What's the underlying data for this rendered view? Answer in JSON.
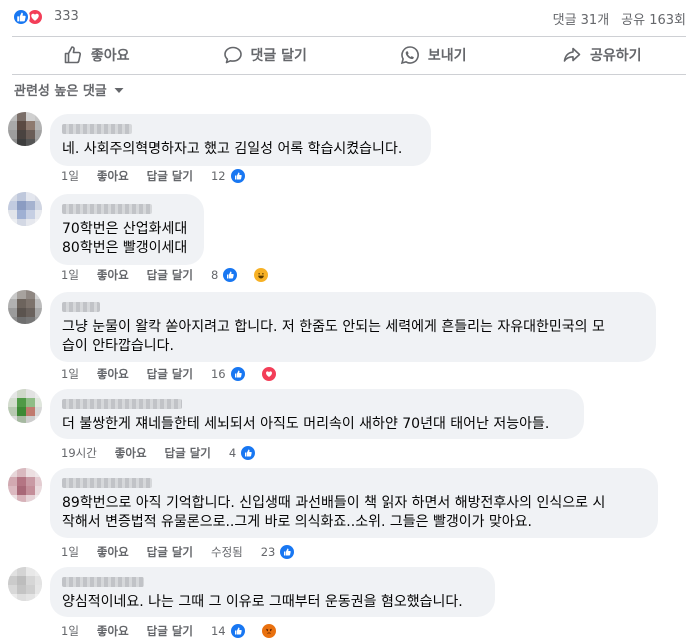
{
  "summary": {
    "reaction_count": "333",
    "comments": "댓글 31개",
    "shares": "공유 163회"
  },
  "actions": {
    "like": "좋아요",
    "comment": "댓글 달기",
    "send": "보내기",
    "share": "공유하기"
  },
  "sort": {
    "label": "관련성 높은 댓글"
  },
  "comments": [
    {
      "text": "네. 사회주의혁명하자고 했고 김일성 어록 학습시켰습니다.",
      "time": "1일",
      "like": "좋아요",
      "reply": "답글 달기",
      "edited": "",
      "reactions": "12"
    },
    {
      "text": "70학번은 산업화세대\n80학번은 빨갱이세대",
      "time": "1일",
      "like": "좋아요",
      "reply": "답글 달기",
      "edited": "",
      "reactions": "8"
    },
    {
      "text": "그냥 눈물이 왈칵 쏟아지려고 합니다. 저 한줌도 안되는 세력에게 흔들리는 자유대한민국의 모\n습이 안타깝습니다.",
      "time": "1일",
      "like": "좋아요",
      "reply": "답글 달기",
      "edited": "",
      "reactions": "16"
    },
    {
      "text": "더 불쌍한게 쟤네들한테 세뇌되서 아직도 머리속이 새하얀 70년대 태어난 저능아들.",
      "time": "19시간",
      "like": "좋아요",
      "reply": "답글 달기",
      "edited": "",
      "reactions": "4"
    },
    {
      "text": "89학번으로 아직 기억합니다. 신입생때 과선배들이 책 읽자 하면서 해방전후사의 인식으로 시\n작해서 변증법적 유물론으로..그게 바로 의식화죠..소위. 그들은 빨갱이가 맞아요.",
      "time": "1일",
      "like": "좋아요",
      "reply": "답글 달기",
      "edited": "수정됨",
      "reactions": "23"
    },
    {
      "text": "양심적이네요. 나는 그때 그 이유로 그때부터 운동권을 혐오했습니다.",
      "time": "1일",
      "like": "좋아요",
      "reply": "답글 달기",
      "edited": "",
      "reactions": "14"
    }
  ]
}
